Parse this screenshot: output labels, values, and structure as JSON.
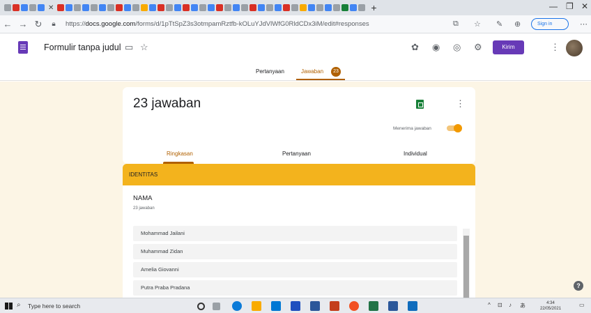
{
  "browser": {
    "url_prefix": "https://",
    "url_domain": "docs.google.com",
    "url_path": "/forms/d/1pTtSpZ3s3otmpamRztfb-kOLuYJdVlWfG0RldCDx3iM/edit#responses",
    "signin_label": "Sign in"
  },
  "form_header": {
    "title": "Formulir tanpa judul",
    "send_label": "Kirim"
  },
  "form_tabs": {
    "questions": "Pertanyaan",
    "responses": "Jawaban",
    "responses_count": "23"
  },
  "summary_card": {
    "count_text": "23 jawaban",
    "accepting_label": "Menerima jawaban",
    "tabs": [
      "Ringkasan",
      "Pertanyaan",
      "Individual"
    ]
  },
  "section": {
    "title": "IDENTITAS"
  },
  "question": {
    "title": "NAMA",
    "subtitle": "23 jawaban",
    "answers": [
      "Mohammad Jailani",
      "Muhammad Zidan",
      "Amelia Giovanni",
      "Putra Praba Pradana"
    ]
  },
  "taskbar": {
    "search_placeholder": "Type here to search",
    "time": "4:34",
    "date": "22/05/2021"
  }
}
